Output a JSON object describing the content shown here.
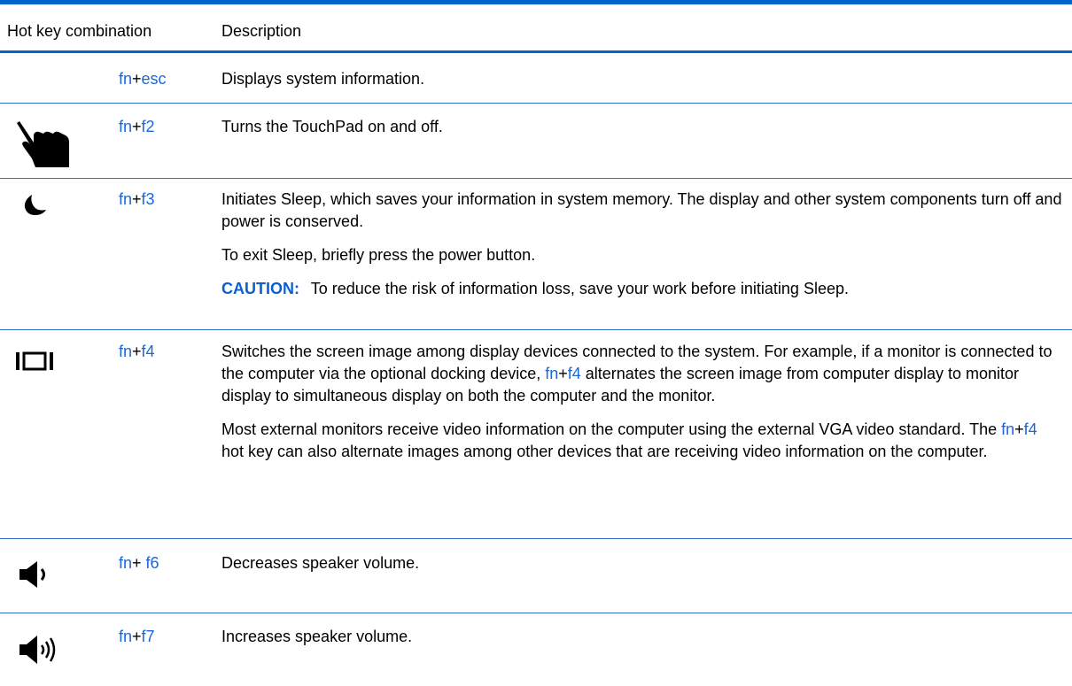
{
  "header": {
    "col1": "Hot key combination",
    "col2": "Description"
  },
  "colors": {
    "rule": "#0066cc",
    "key_link": "#1a66d9",
    "caution": "#0a5fd1"
  },
  "rows": [
    {
      "icon": "",
      "key1": "fn",
      "plus": "+",
      "key2": "esc",
      "desc": [
        "Displays system information."
      ]
    },
    {
      "icon": "touchpad-hand-icon",
      "key1": "fn",
      "plus": "+",
      "key2": "f2",
      "desc": [
        "Turns the TouchPad on and off."
      ]
    },
    {
      "icon": "sleep-moon-icon",
      "key1": "fn",
      "plus": "+",
      "key2": "f3",
      "desc": [
        "Initiates Sleep, which saves your information in system memory. The display and other system components turn off and power is conserved.",
        "To exit Sleep, briefly press the power button."
      ],
      "caution_label": "CAUTION:",
      "caution_text": "To reduce the risk of information loss, save your work before initiating Sleep."
    },
    {
      "icon": "display-switch-icon",
      "key1": "fn",
      "plus": "+",
      "key2": "f4",
      "desc_a_pre": "Switches the screen image among display devices connected to the system. For example, if a monitor is connected to the computer via the optional docking device, ",
      "desc_a_key1": "fn",
      "desc_a_plus": "+",
      "desc_a_key2": "f4",
      "desc_a_post": " alternates the screen image from computer display to monitor display to simultaneous display on both the computer and the monitor.",
      "desc_b_pre": "Most external monitors receive video information on the computer using the external VGA video standard. The ",
      "desc_b_key1": "fn",
      "desc_b_plus": "+",
      "desc_b_key2": "f4",
      "desc_b_post": " hot key can also alternate images among other devices that are receiving video information on the computer."
    },
    {
      "icon": "volume-down-icon",
      "key1": "fn",
      "plus": "+ ",
      "key2": "f6",
      "desc": [
        "Decreases speaker volume."
      ]
    },
    {
      "icon": "volume-up-icon",
      "key1": "fn",
      "plus": "+",
      "key2": "f7",
      "desc": [
        "Increases speaker volume."
      ]
    }
  ]
}
